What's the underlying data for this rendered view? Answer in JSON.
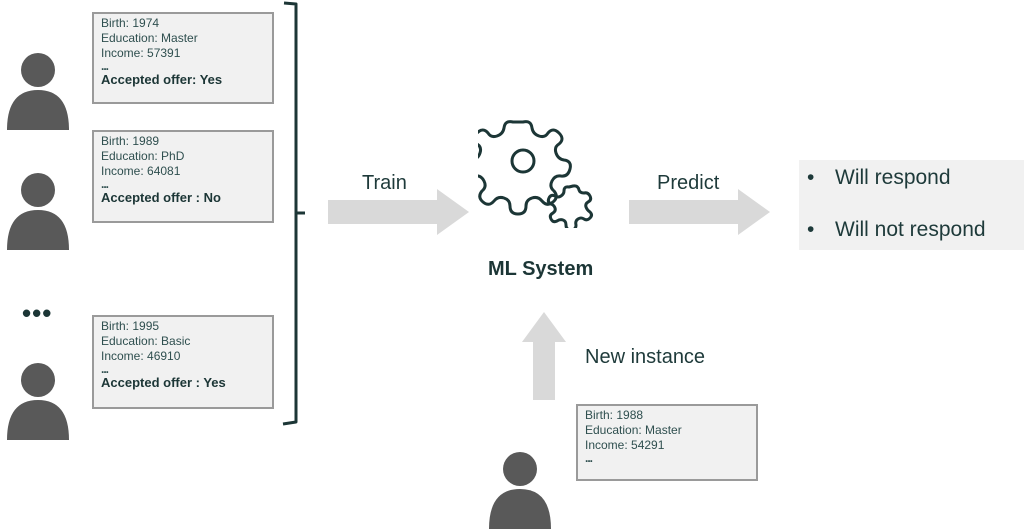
{
  "training_examples": [
    {
      "birth": "Birth: 1974",
      "education": "Education: Master",
      "income": "Income: 57391",
      "ellipsis": "...",
      "accepted": "Accepted offer: Yes"
    },
    {
      "birth": "Birth: 1989",
      "education": "Education: PhD",
      "income": "Income: 64081",
      "ellipsis": "...",
      "accepted": "Accepted offer : No"
    },
    {
      "birth": "Birth: 1995",
      "education": "Education: Basic",
      "income": "Income: 46910",
      "ellipsis": "...",
      "accepted": "Accepted offer : Yes"
    }
  ],
  "more_examples_indicator": "•••",
  "train_label": "Train",
  "ml_system_label": "ML System",
  "predict_label": "Predict",
  "predictions": [
    {
      "bullet": "•",
      "text": "Will respond"
    },
    {
      "bullet": "•",
      "text": "Will not respond"
    }
  ],
  "new_instance_label": "New instance",
  "new_instance": {
    "birth": "Birth: 1988",
    "education": "Education: Master",
    "income": "Income: 54291",
    "ellipsis": "..."
  },
  "colors": {
    "accent": "#1c3636",
    "person": "#595959",
    "arrow": "#d9d9d9",
    "card_bg": "#f1f1f1",
    "card_border": "#9a9a9a"
  }
}
